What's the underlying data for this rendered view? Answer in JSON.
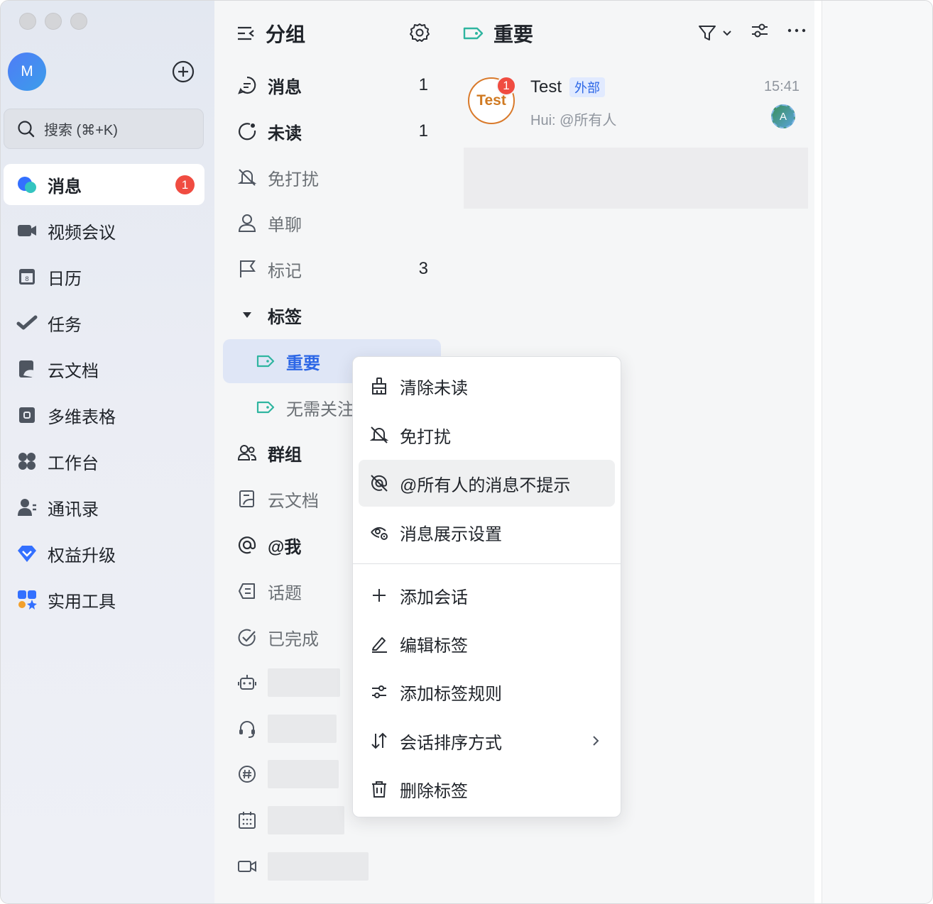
{
  "sidebar": {
    "avatar_letter": "M",
    "search_placeholder": "搜索 (⌘+K)",
    "items": [
      {
        "label": "消息",
        "icon": "message-bubble-icon",
        "badge": "1",
        "active": true
      },
      {
        "label": "视频会议",
        "icon": "video-camera-icon"
      },
      {
        "label": "日历",
        "icon": "calendar-icon"
      },
      {
        "label": "任务",
        "icon": "task-check-icon"
      },
      {
        "label": "云文档",
        "icon": "cloud-doc-icon"
      },
      {
        "label": "多维表格",
        "icon": "base-table-icon"
      },
      {
        "label": "工作台",
        "icon": "workplace-grid-icon"
      },
      {
        "label": "通讯录",
        "icon": "contacts-icon"
      },
      {
        "label": "权益升级",
        "icon": "diamond-icon"
      },
      {
        "label": "实用工具",
        "icon": "tools-icon"
      }
    ]
  },
  "groups": {
    "title": "分组",
    "items": [
      {
        "label": "消息",
        "count": "1"
      },
      {
        "label": "未读",
        "count": "1"
      },
      {
        "label": "免打扰"
      },
      {
        "label": "单聊"
      },
      {
        "label": "标记",
        "count": "3"
      },
      {
        "label": "标签"
      },
      {
        "label": "重要"
      },
      {
        "label": "无需关注"
      },
      {
        "label": "群组"
      },
      {
        "label": "云文档"
      },
      {
        "label": "@我"
      },
      {
        "label": "话题"
      },
      {
        "label": "已完成"
      }
    ]
  },
  "chats": {
    "title": "重要",
    "rows": [
      {
        "avatar_text": "Test",
        "badge": "1",
        "name": "Test",
        "tag": "外部",
        "time": "15:41",
        "preview": "Hui: @所有人",
        "member_avatar": "A"
      }
    ]
  },
  "context_menu": {
    "items": [
      {
        "label": "清除未读",
        "icon": "broom-icon"
      },
      {
        "label": "免打扰",
        "icon": "bell-off-icon"
      },
      {
        "label": "@所有人的消息不提示",
        "icon": "at-off-icon"
      },
      {
        "label": "消息展示设置",
        "icon": "eye-settings-icon"
      },
      {
        "label": "添加会话",
        "icon": "plus-icon"
      },
      {
        "label": "编辑标签",
        "icon": "pencil-icon"
      },
      {
        "label": "添加标签规则",
        "icon": "sliders-icon"
      },
      {
        "label": "会话排序方式",
        "icon": "sort-icon"
      },
      {
        "label": "删除标签",
        "icon": "trash-icon"
      }
    ]
  },
  "colors": {
    "accent": "#2d67e6",
    "badge": "#f04c41",
    "tag_green": "#2fb5a0"
  }
}
